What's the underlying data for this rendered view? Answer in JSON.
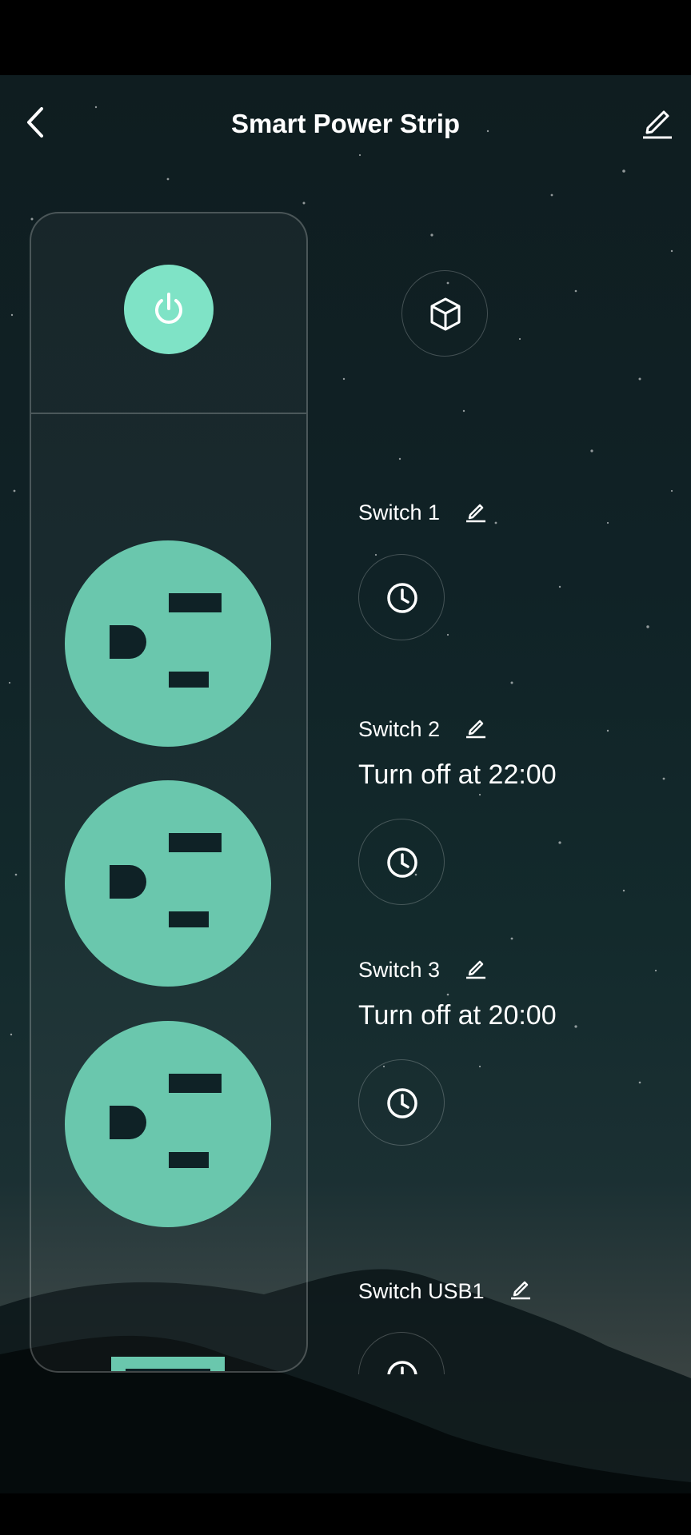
{
  "header": {
    "title": "Smart Power Strip",
    "back_icon": "chevron-left-icon",
    "edit_icon": "pencil-icon"
  },
  "strip": {
    "master_power_icon": "power-icon",
    "scene_icon": "cube-icon"
  },
  "switches": [
    {
      "label": "Switch 1",
      "status": ""
    },
    {
      "label": "Switch 2",
      "status": "Turn off at 22:00"
    },
    {
      "label": "Switch 3",
      "status": "Turn off at 20:00"
    },
    {
      "label": "Switch USB1",
      "status": ""
    }
  ],
  "colors": {
    "accent": "#7fe3c6",
    "outlet": "#6ac7ad",
    "background": "#102226"
  }
}
